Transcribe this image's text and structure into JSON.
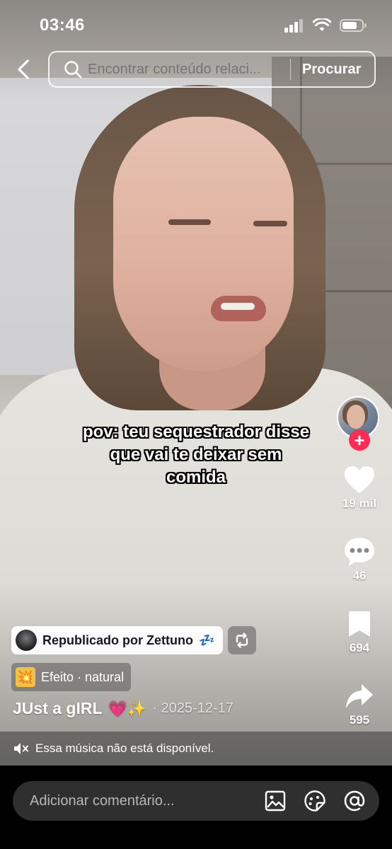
{
  "status_bar": {
    "time": "03:46",
    "icons": [
      "cellular-signal-icon",
      "wifi-icon",
      "battery-icon"
    ]
  },
  "search": {
    "placeholder": "Encontrar conteúdo relaci...",
    "button_label": "Procurar"
  },
  "caption": {
    "lines": [
      "pov: teu sequestrador disse",
      "que vai te deixar sem",
      "comida"
    ]
  },
  "actions": {
    "like_count": "19 mil",
    "comment_count": "46",
    "save_count": "694",
    "share_count": "595",
    "follow_symbol": "+"
  },
  "repost": {
    "label": "Republicado por Zettuno",
    "emoji": "💤"
  },
  "effect": {
    "emoji": "💥",
    "label": "Efeito · natural"
  },
  "author": {
    "name": "JUst a gIRL",
    "emoji": "💗✨",
    "date": "· 2025-12-17"
  },
  "music": {
    "text": "Essa música não está disponível."
  },
  "comment": {
    "placeholder": "Adicionar comentário..."
  },
  "colors": {
    "accent": "#fe2c55",
    "comment_bg": "#2f2f2f"
  }
}
